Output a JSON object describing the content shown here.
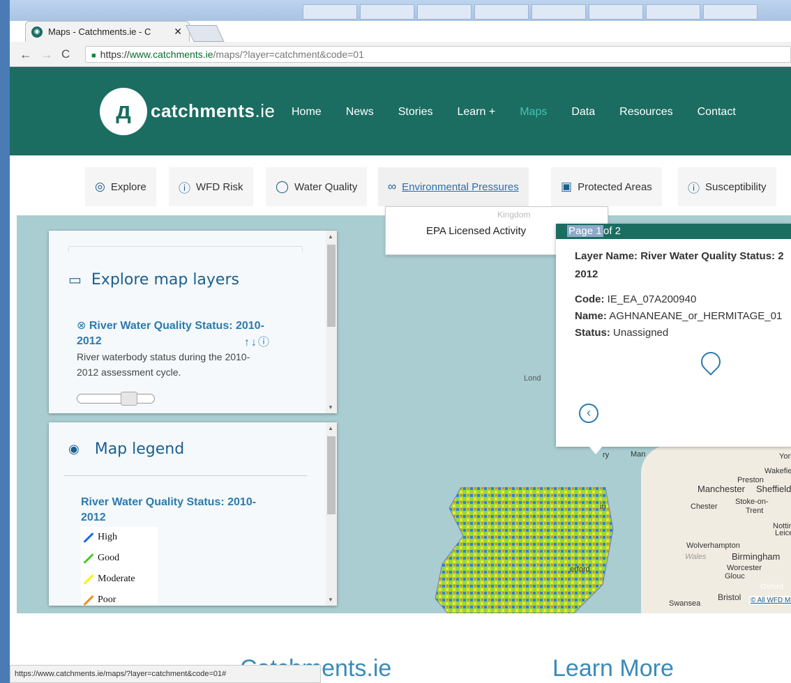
{
  "browser": {
    "tab_title": "Maps - Catchments.ie - C",
    "url_scheme": "https://",
    "url_host": "www.catchments.ie",
    "url_path": "/maps/?layer=catchment&code=01",
    "status_url": "https://www.catchments.ie/maps/?layer=catchment&code=01#"
  },
  "site": {
    "logo_name": "catchments",
    "logo_tld": ".ie",
    "nav": [
      "Home",
      "News",
      "Stories",
      "Learn +",
      "Maps",
      "Data",
      "Resources",
      "Contact"
    ],
    "active_nav": "Maps"
  },
  "map_tabs": [
    {
      "label": "Explore",
      "icon": "location-pin-icon"
    },
    {
      "label": "WFD Risk",
      "icon": "alert-icon"
    },
    {
      "label": "Water Quality",
      "icon": "water-drop-icon"
    },
    {
      "label": "Environmental Pressures",
      "icon": "binoculars-icon"
    },
    {
      "label": "Protected Areas",
      "icon": "padlock-icon"
    },
    {
      "label": "Susceptibility",
      "icon": "info-icon"
    }
  ],
  "dropdown": {
    "item": "EPA Licensed Activity",
    "faint_label": "Kingdom"
  },
  "explore_panel": {
    "title": "Explore map layers",
    "layer_title": "River Water Quality Status: 2010-2012",
    "layer_title_line1": "River Water Quality Status: 2010-",
    "layer_title_line2": "2012",
    "description_line1": "River waterbody status during the 2010-",
    "description_line2": "2012 assessment cycle.",
    "opacity_fraction": 0.72
  },
  "legend_panel": {
    "title": "Map legend",
    "layer_title_line1": "River Water Quality Status: 2010-",
    "layer_title_line2": "2012",
    "items": [
      {
        "label": "High",
        "color": "#1a6be0"
      },
      {
        "label": "Good",
        "color": "#44cc22"
      },
      {
        "label": "Moderate",
        "color": "#f5f500"
      },
      {
        "label": "Poor",
        "color": "#e8901a"
      }
    ]
  },
  "popup": {
    "page_label": "Page 1",
    "page_of": "of 2",
    "layer_name_label": "Layer Name:",
    "layer_name_line1": "River Water Quality Status: 2",
    "layer_name_line2": "2012",
    "code_label": "Code:",
    "code_value": "IE_EA_07A200940",
    "name_label": "Name:",
    "name_value": "AGHNANEANE_or_HERMITAGE_01",
    "status_label": "Status:",
    "status_value": "Unassigned"
  },
  "map_labels": {
    "man": "Man",
    "york": "York",
    "preston": "Preston",
    "wakefield": "Wakefield",
    "manchester": "Manchester",
    "sheffield": "Sheffield",
    "chester": "Chester",
    "stoke": "Stoke-on-",
    "trent": "Trent",
    "nottingham": "Nottingha",
    "leicester": "Leiceste",
    "wolverhampton": "Wolverhampton",
    "wales": "Wales",
    "birmingham": "Birmingham",
    "worcester": "Worcester",
    "gloucester": "Glouc",
    "bristol": "Bristol",
    "swansea": "Swansea",
    "oxford": "Oxford",
    "attribution": "© All WFD Ma",
    "lond": "Lond",
    "ry": "ry",
    "in": "in",
    "erford": "erford"
  },
  "footer": {
    "left_title": "Catchments.ie",
    "right_title": "Learn More"
  }
}
